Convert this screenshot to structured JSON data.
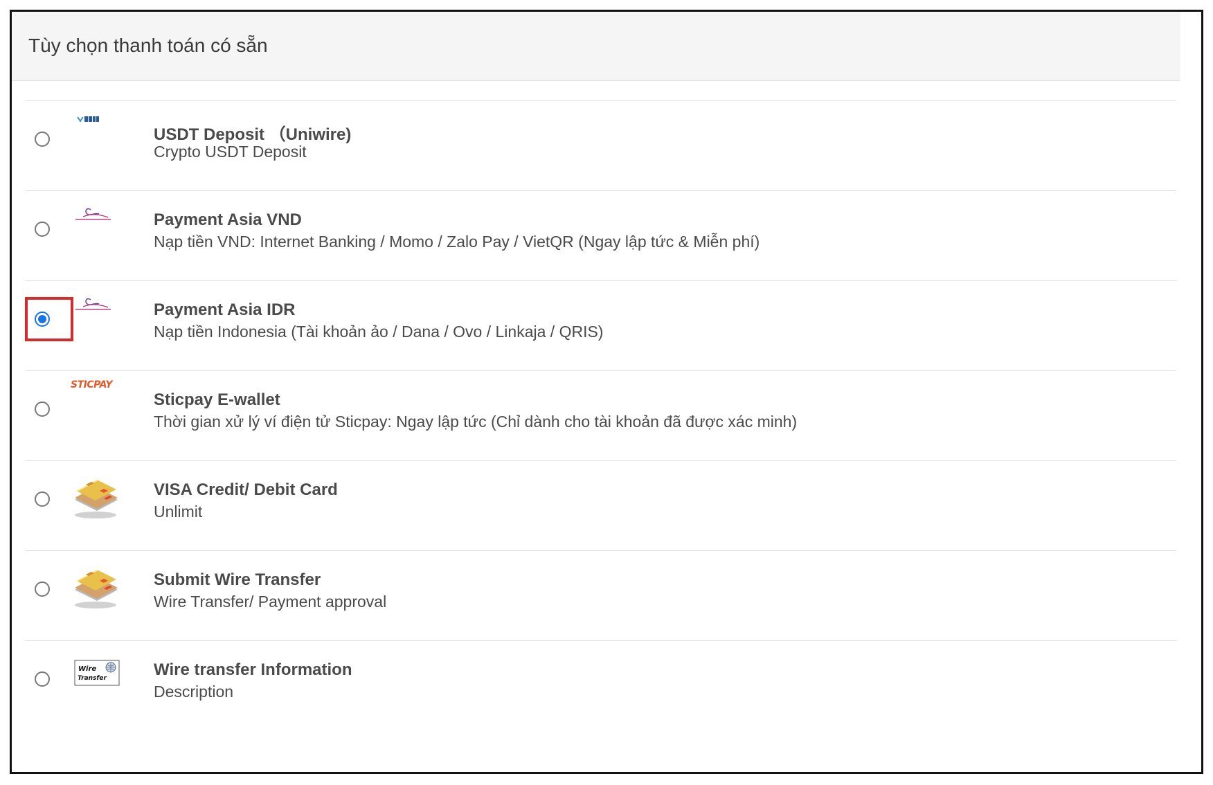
{
  "panel": {
    "title": "Tùy chọn thanh toán có sẵn"
  },
  "colors": {
    "accent": "#1a73e8",
    "highlight": "#d62b2b",
    "sticpay_orange": "#e2582a"
  },
  "payment_options": [
    {
      "title": "USDT Deposit （Uniwire)",
      "description": "Crypto USDT Deposit",
      "icon": "uniwire-logo-icon",
      "selected": false
    },
    {
      "title": "Payment Asia VND",
      "description": "Nạp tiền VND: Internet Banking / Momo / Zalo Pay / VietQR (Ngay lập tức & Miễn phí)",
      "icon": "payment-asia-logo-icon",
      "selected": false
    },
    {
      "title": "Payment Asia IDR",
      "description": "Nạp tiền Indonesia (Tài khoản ảo / Dana / Ovo / Linkaja / QRIS)",
      "icon": "payment-asia-logo-icon",
      "selected": true
    },
    {
      "title": "Sticpay E-wallet",
      "description": "Thời gian xử lý ví điện tử Sticpay: Ngay lập tức (Chỉ dành cho tài khoản đã được xác minh)",
      "icon": "sticpay-logo-icon",
      "logo_text": "STICPAY",
      "selected": false
    },
    {
      "title": "VISA Credit/ Debit Card",
      "description": "Unlimit",
      "icon": "credit-card-icon",
      "selected": false
    },
    {
      "title": "Submit Wire Transfer",
      "description": "Wire Transfer/ Payment approval",
      "icon": "credit-card-icon",
      "selected": false
    },
    {
      "title": "Wire transfer Information",
      "description": "Description",
      "icon": "wire-transfer-logo-icon",
      "logo_text": "Wire Transfer",
      "selected": false
    }
  ]
}
